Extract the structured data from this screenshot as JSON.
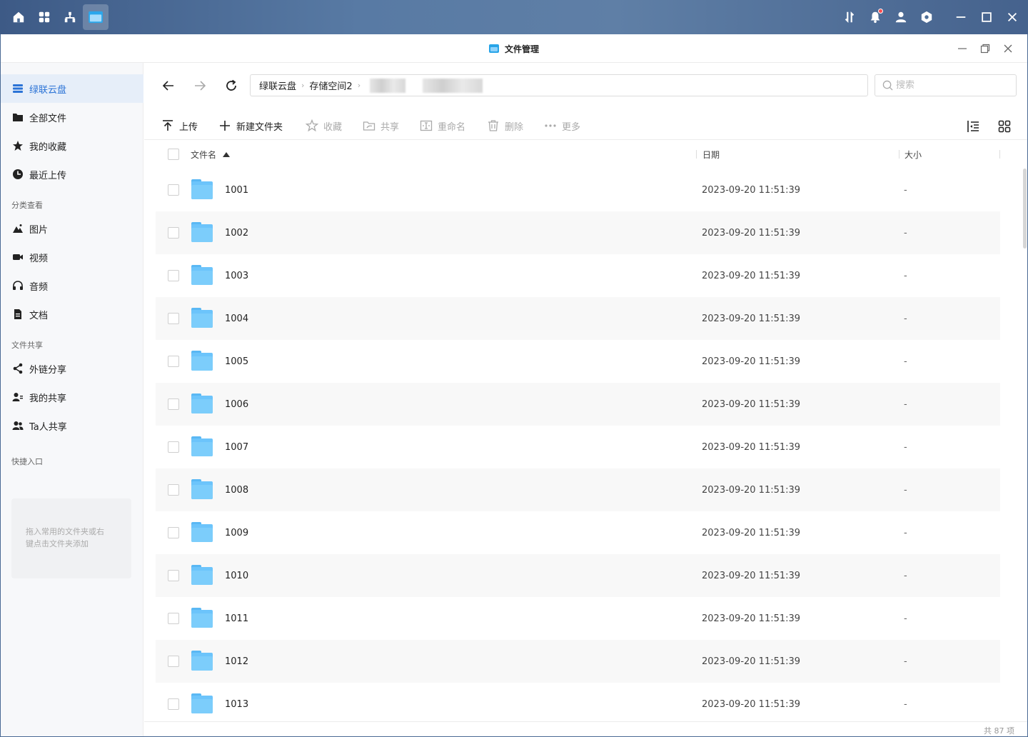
{
  "window": {
    "title": "文件管理"
  },
  "sidebar": {
    "items": [
      {
        "label": "绿联云盘",
        "icon": "stack-icon",
        "active": true
      },
      {
        "label": "全部文件",
        "icon": "folder-icon"
      },
      {
        "label": "我的收藏",
        "icon": "star-icon"
      },
      {
        "label": "最近上传",
        "icon": "clock-icon"
      }
    ],
    "group_category": "分类查看",
    "category_items": [
      {
        "label": "图片",
        "icon": "mountain-icon"
      },
      {
        "label": "视频",
        "icon": "video-icon"
      },
      {
        "label": "音频",
        "icon": "headphones-icon"
      },
      {
        "label": "文档",
        "icon": "document-icon"
      }
    ],
    "group_share": "文件共享",
    "share_items": [
      {
        "label": "外链分享",
        "icon": "share-icon"
      },
      {
        "label": "我的共享",
        "icon": "user-share-icon"
      },
      {
        "label": "Ta人共享",
        "icon": "users-icon"
      }
    ],
    "group_quick": "快捷入口",
    "quick_hint_line1": "拖入常用的文件夹或右",
    "quick_hint_line2": "键点击文件夹添加"
  },
  "path": {
    "root": "绿联云盘",
    "second": "存储空间2"
  },
  "search": {
    "placeholder": "搜索"
  },
  "toolbar": {
    "upload": "上传",
    "new_folder": "新建文件夹",
    "favorite": "收藏",
    "share": "共享",
    "rename": "重命名",
    "delete": "删除",
    "more": "更多"
  },
  "table": {
    "headers": {
      "name": "文件名",
      "date": "日期",
      "size": "大小"
    },
    "rows": [
      {
        "name": "1001",
        "date": "2023-09-20 11:51:39",
        "size": "-"
      },
      {
        "name": "1002",
        "date": "2023-09-20 11:51:39",
        "size": "-"
      },
      {
        "name": "1003",
        "date": "2023-09-20 11:51:39",
        "size": "-"
      },
      {
        "name": "1004",
        "date": "2023-09-20 11:51:39",
        "size": "-"
      },
      {
        "name": "1005",
        "date": "2023-09-20 11:51:39",
        "size": "-"
      },
      {
        "name": "1006",
        "date": "2023-09-20 11:51:39",
        "size": "-"
      },
      {
        "name": "1007",
        "date": "2023-09-20 11:51:39",
        "size": "-"
      },
      {
        "name": "1008",
        "date": "2023-09-20 11:51:39",
        "size": "-"
      },
      {
        "name": "1009",
        "date": "2023-09-20 11:51:39",
        "size": "-"
      },
      {
        "name": "1010",
        "date": "2023-09-20 11:51:39",
        "size": "-"
      },
      {
        "name": "1011",
        "date": "2023-09-20 11:51:39",
        "size": "-"
      },
      {
        "name": "1012",
        "date": "2023-09-20 11:51:39",
        "size": "-"
      },
      {
        "name": "1013",
        "date": "2023-09-20 11:51:39",
        "size": "-"
      }
    ]
  },
  "footer": {
    "count": "共 87 项"
  },
  "colors": {
    "accent": "#2b73d6",
    "folder": "#6cc4fb",
    "topbar": "#4a6a94"
  }
}
